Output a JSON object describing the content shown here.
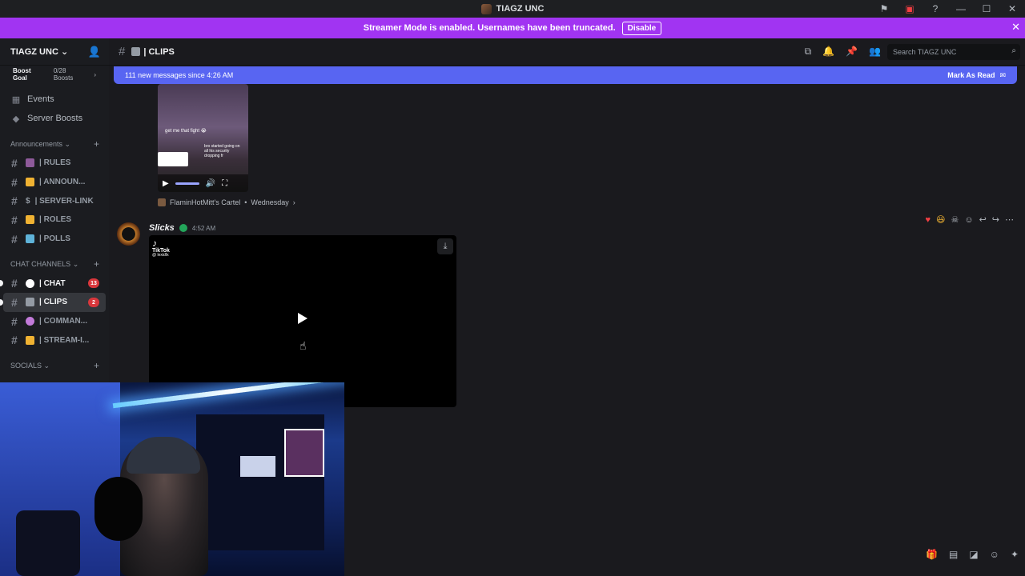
{
  "titlebar": {
    "title": "TIAGZ UNC"
  },
  "banner": {
    "message": "Streamer Mode is enabled. Usernames have been truncated.",
    "disable_label": "Disable"
  },
  "server": {
    "name": "TIAGZ UNC",
    "boost_goal": "Boost Goal",
    "boost_count": "0/28 Boosts"
  },
  "sidebar": {
    "top_items": [
      {
        "label": "Events",
        "icon": "calendar-icon"
      },
      {
        "label": "Server Boosts",
        "icon": "boost-icon"
      }
    ],
    "categories": [
      {
        "name": "Announcements",
        "channels": [
          "| RULES",
          "| ANNOUN...",
          "| SERVER-LINK",
          "| ROLES",
          "| POLLS"
        ]
      },
      {
        "name": "CHAT CHANNELS",
        "channels": [
          "| CHAT",
          "| CLIPS",
          "| COMMAN...",
          "| STREAM-I..."
        ],
        "badges": [
          "13",
          "2"
        ]
      },
      {
        "name": "SOCIALS"
      }
    ]
  },
  "header": {
    "channel_name": "| CLIPS",
    "search_placeholder": "Search TIAGZ UNC"
  },
  "newbar": {
    "text": "111 new messages since 4:26 AM",
    "mark_label": "Mark As Read"
  },
  "prev_message": {
    "caption1": "get me that fight 😭",
    "caption2": "bro started going on all his security dropping fr",
    "thread": "FlaminHotMitt's Cartel",
    "thread_time": "Wednesday"
  },
  "message": {
    "author": "Slicks",
    "time": "4:52 AM",
    "video_brand": "TikTok",
    "video_handle": "@ lexidfx"
  },
  "colors": {
    "banner": "#a134f2",
    "blurple": "#5865f2",
    "badge": "#da373c"
  }
}
